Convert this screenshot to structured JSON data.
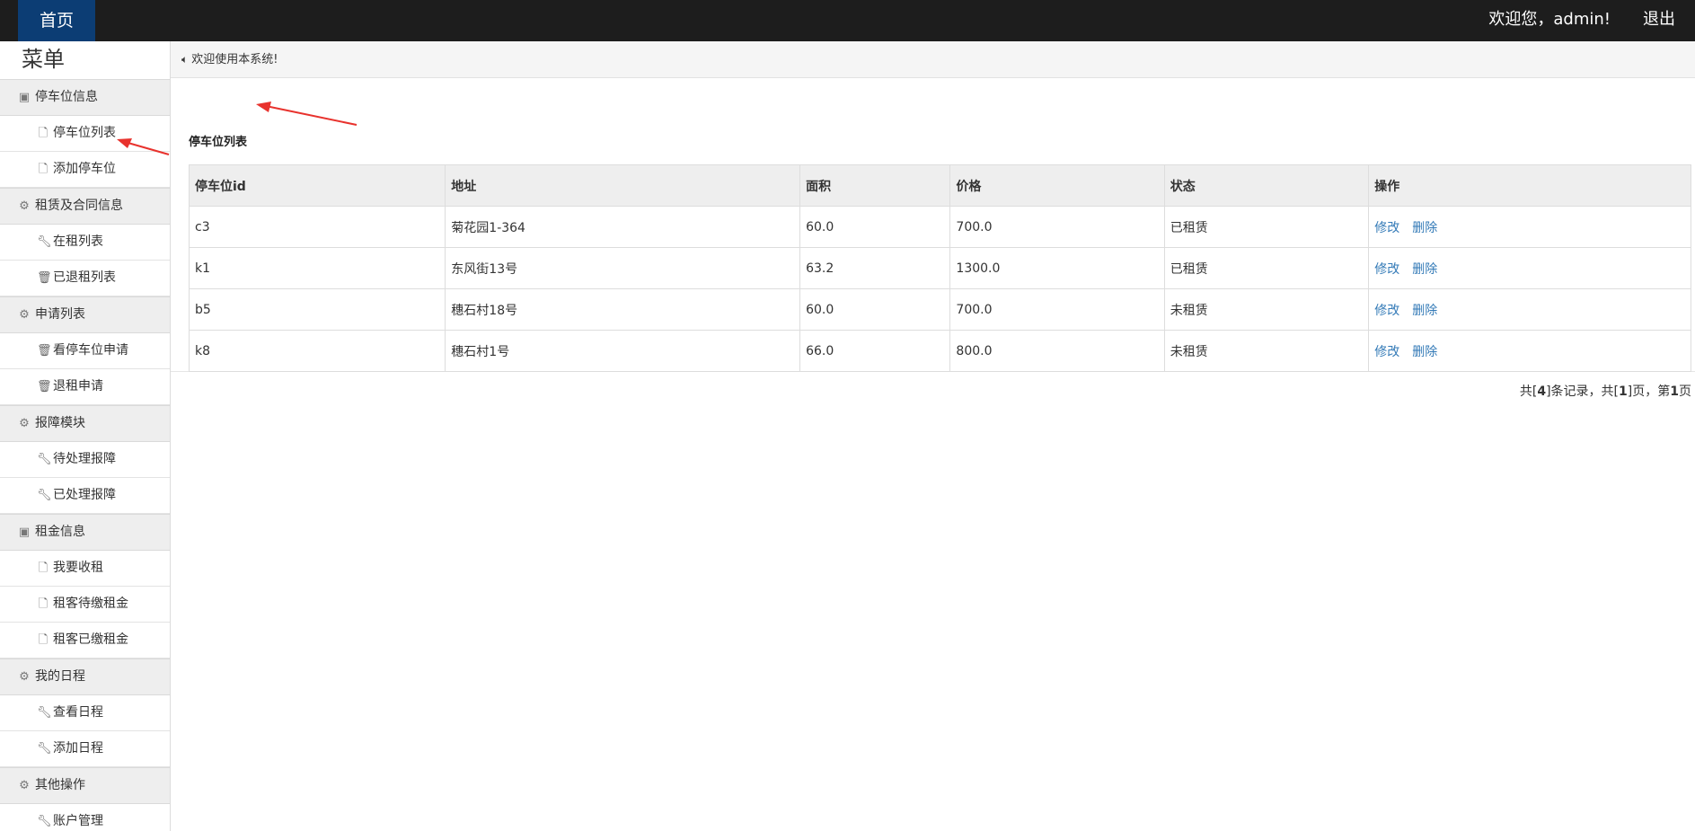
{
  "topbar": {
    "home": "首页",
    "welcome": "欢迎您，admin!",
    "logout": "退出"
  },
  "sidebar": {
    "title": "菜单",
    "groups": [
      {
        "label": "停车位信息",
        "icon": "contact-card-icon",
        "items": [
          {
            "label": "停车位列表",
            "icon": "file-icon"
          },
          {
            "label": "添加停车位",
            "icon": "file-icon"
          }
        ]
      },
      {
        "label": "租赁及合同信息",
        "icon": "gear-icon",
        "items": [
          {
            "label": "在租列表",
            "icon": "wrench-icon"
          },
          {
            "label": "已退租列表",
            "icon": "trash-icon"
          }
        ]
      },
      {
        "label": "申请列表",
        "icon": "gear-icon",
        "items": [
          {
            "label": "看停车位申请",
            "icon": "trash-icon"
          },
          {
            "label": "退租申请",
            "icon": "trash-icon"
          }
        ]
      },
      {
        "label": "报障模块",
        "icon": "gear-icon",
        "items": [
          {
            "label": "待处理报障",
            "icon": "wrench-icon"
          },
          {
            "label": "已处理报障",
            "icon": "wrench-icon"
          }
        ]
      },
      {
        "label": "租金信息",
        "icon": "contact-card-icon",
        "items": [
          {
            "label": "我要收租",
            "icon": "file-icon"
          },
          {
            "label": "租客待缴租金",
            "icon": "file-icon"
          },
          {
            "label": "租客已缴租金",
            "icon": "file-icon"
          }
        ]
      },
      {
        "label": "我的日程",
        "icon": "gear-icon",
        "items": [
          {
            "label": "查看日程",
            "icon": "wrench-icon"
          },
          {
            "label": "添加日程",
            "icon": "wrench-icon"
          }
        ]
      },
      {
        "label": "其他操作",
        "icon": "gear-icon",
        "items": [
          {
            "label": "账户管理",
            "icon": "wrench-icon"
          }
        ]
      }
    ]
  },
  "notice": {
    "text": "欢迎使用本系统!",
    "icon": "speaker-icon"
  },
  "list": {
    "title": "停车位列表",
    "columns": [
      "停车位id",
      "地址",
      "面积",
      "价格",
      "状态",
      "操作"
    ],
    "rows": [
      {
        "id": "c3",
        "address": "菊花园1-364",
        "area": "60.0",
        "price": "700.0",
        "status": "已租赁"
      },
      {
        "id": "k1",
        "address": "东风街13号",
        "area": "63.2",
        "price": "1300.0",
        "status": "已租赁"
      },
      {
        "id": "b5",
        "address": "穗石村18号",
        "area": "60.0",
        "price": "700.0",
        "status": "未租赁"
      },
      {
        "id": "k8",
        "address": "穗石村1号",
        "area": "66.0",
        "price": "800.0",
        "status": "未租赁"
      }
    ],
    "actions": {
      "edit": "修改",
      "delete": "删除"
    }
  },
  "pager": {
    "prefix": "共[",
    "total": "4",
    "mid1": "]条记录，共[",
    "pages": "1",
    "mid2": "]页，第",
    "current": "1",
    "suffix": "页"
  },
  "colors": {
    "topbar": "#1d1d1d",
    "home_tab": "#0c3d74",
    "link": "#337ab7",
    "arrow": "#e8322d"
  }
}
